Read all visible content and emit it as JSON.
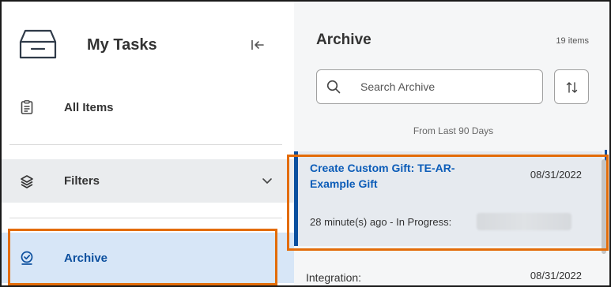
{
  "left_panel": {
    "title": "My Tasks",
    "nav": {
      "all_items": "All Items",
      "filters": "Filters",
      "archive": "Archive"
    }
  },
  "right_panel": {
    "title": "Archive",
    "count": "19 items",
    "search": {
      "placeholder": "Search Archive",
      "value": ""
    },
    "subheading": "From Last 90 Days",
    "tasks": [
      {
        "title": "Create Custom Gift: TE-AR-Example Gift",
        "date": "08/31/2022",
        "status": "28 minute(s) ago - In Progress:"
      },
      {
        "title": "Integration:",
        "date": "08/31/2022"
      }
    ]
  },
  "colors": {
    "accent": "#0b4f9e",
    "highlight": "#e36c09",
    "selected_bg": "#d7e6f7",
    "filters_bg": "#eaecee"
  },
  "icons": {
    "inbox": "inbox-icon",
    "collapse": "collapse-panel-icon",
    "all_items": "clipboard-icon",
    "filters": "layers-icon",
    "filters_chevron": "chevron-down-icon",
    "archive": "check-circle-icon",
    "search": "search-icon",
    "sort": "sort-icon"
  }
}
